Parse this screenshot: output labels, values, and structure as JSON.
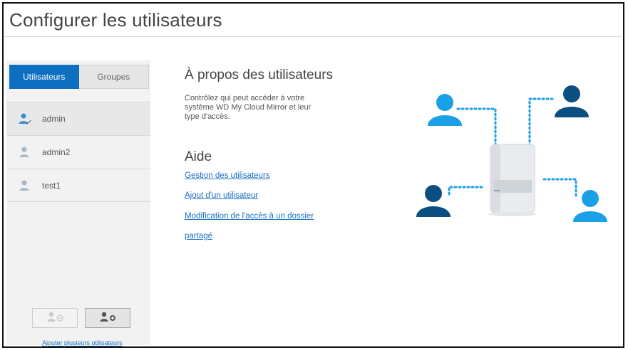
{
  "page": {
    "title": "Configurer les utilisateurs"
  },
  "tabs": {
    "users_label": "Utilisateurs",
    "groups_label": "Groupes"
  },
  "users": [
    {
      "name": "admin",
      "selected": true
    },
    {
      "name": "admin2",
      "selected": false
    },
    {
      "name": "test1",
      "selected": false
    }
  ],
  "sidebar": {
    "remove_user_icon": "user-minus-icon",
    "add_user_icon": "user-plus-icon",
    "add_multiple_link": "Ajouter plusieurs utilisateurs"
  },
  "about": {
    "heading": "À propos des utilisateurs",
    "line1": "Contrôlez qui peut accéder à votre",
    "line2": "système WD My Cloud Mirror et leur",
    "line3": "type d'accès."
  },
  "help": {
    "heading": "Aide",
    "links": [
      "Gestion des utilisateurs",
      "Ajout d'un utilisateur",
      "Modification de l'accès à un dossier",
      "partagé"
    ]
  },
  "colors": {
    "accent": "#0e6fc1",
    "link": "#1a6fc0",
    "user_light": "#1aa0e6",
    "user_dark": "#0b4f82"
  }
}
